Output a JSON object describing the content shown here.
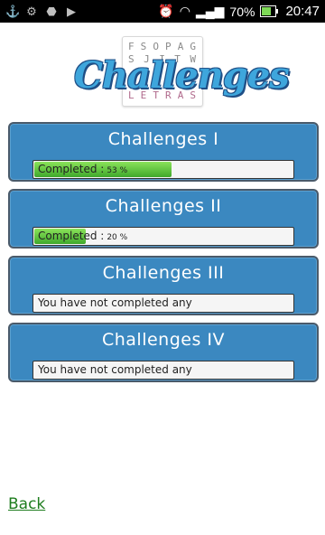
{
  "status_bar": {
    "icons_left": [
      "usb-icon",
      "debug-icon",
      "android-icon",
      "media-icon"
    ],
    "battery_percent": "70%",
    "time": "20:47",
    "battery_level": 0.7
  },
  "logo": {
    "word": "Challenges",
    "tile_row_1": [
      "F",
      "S",
      "O",
      "P",
      "A",
      "G"
    ],
    "tile_row_2": [
      "S",
      "J",
      "I",
      "T",
      "W"
    ],
    "tile_row_3": [
      "L",
      "E",
      "T",
      "R",
      "A",
      "S"
    ]
  },
  "challenges": [
    {
      "title": "Challenges I",
      "status": "Completed :",
      "percent_label": "53 %",
      "progress": 0.53
    },
    {
      "title": "Challenges II",
      "status": "Completed :",
      "percent_label": "20 %",
      "progress": 0.2
    },
    {
      "title": "Challenges III",
      "status": "You have not completed any",
      "percent_label": "",
      "progress": 0
    },
    {
      "title": "Challenges IV",
      "status": "You have not completed any",
      "percent_label": "",
      "progress": 0
    }
  ],
  "back_label": "Back",
  "colors": {
    "card_bg": "#3b88c0",
    "progress_green": "#3fa82b",
    "back_link": "#1e7d1e"
  }
}
